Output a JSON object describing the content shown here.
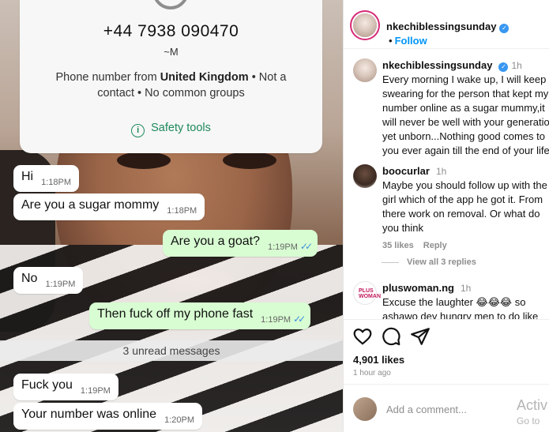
{
  "chat": {
    "phone": "+44 7938 090470",
    "handle": "~M",
    "info_prefix": "Phone number from ",
    "info_country": "United Kingdom",
    "info_suffix": " • Not a contact • No common groups",
    "safety_tools": "Safety tools",
    "messages": [
      {
        "text": "Hi",
        "time": "1:18PM",
        "direction": "in"
      },
      {
        "text": "Are you a sugar mommy",
        "time": "1:18PM",
        "direction": "in"
      },
      {
        "text": "Are you a goat?",
        "time": "1:19PM",
        "direction": "out"
      },
      {
        "text": "No",
        "time": "1:19PM",
        "direction": "in"
      },
      {
        "text": "Then fuck off my phone fast",
        "time": "1:19PM",
        "direction": "out"
      },
      {
        "text": "Fuck you",
        "time": "1:19PM",
        "direction": "in"
      },
      {
        "text": "Your number was online",
        "time": "1:20PM",
        "direction": "in"
      }
    ],
    "unread": "3 unread messages"
  },
  "post": {
    "header_user": "nkechiblessingsunday",
    "follow": "Follow",
    "caption": {
      "user": "nkechiblessingsunday",
      "age": "1h",
      "text": "Every morning I wake up, I will keep swearing for the person that kept my number online as a sugar mummy,it will never be well with your generation yet unborn...Nothing good comes to you ever again till the end of your life.."
    },
    "comments": [
      {
        "user": "boocurlar",
        "age": "1h",
        "text": "Maybe you should follow up with the girl which of the app he got it. From there work on removal. Or what do you think",
        "likes": "35 likes",
        "reply": "Reply"
      },
      {
        "user": "pluswoman.ng",
        "age": "1h",
        "text": "Excuse the laughter 😂😂😂 so ashawo dey hungry men to do like"
      }
    ],
    "view_all": "View all 3 replies",
    "likes": "4,901 likes",
    "time_ago": "1 hour ago",
    "add_comment_placeholder": "Add a comment...",
    "avatar_badge": "PLUS WOMAN"
  },
  "watermark": {
    "line1": "Activ",
    "line2": "Go to"
  }
}
